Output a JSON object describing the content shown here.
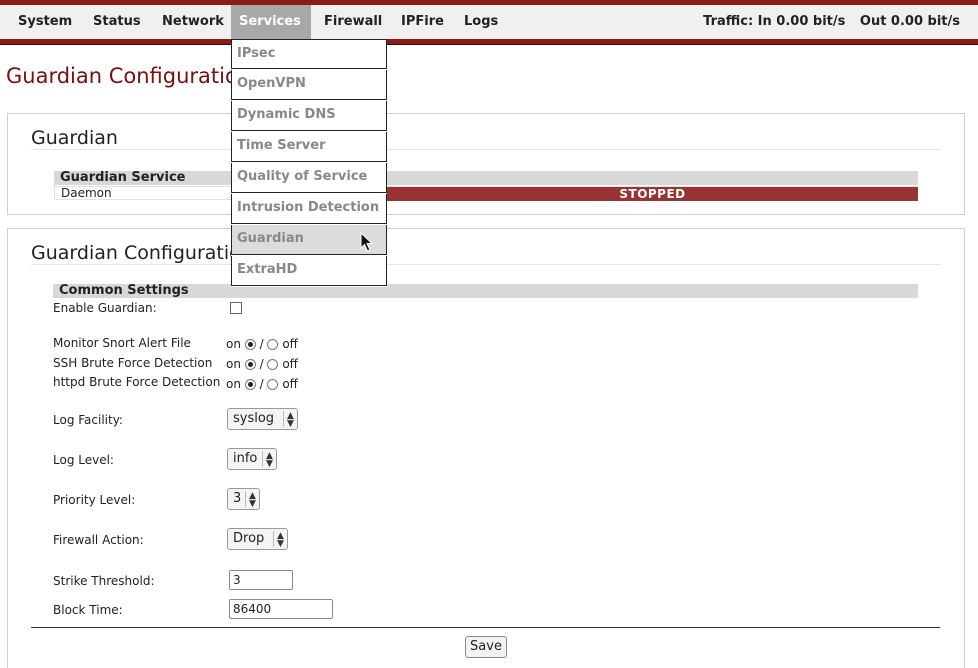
{
  "nav": {
    "items": [
      {
        "label": "System"
      },
      {
        "label": "Status"
      },
      {
        "label": "Network"
      },
      {
        "label": "Services"
      },
      {
        "label": "Firewall"
      },
      {
        "label": "IPFire"
      },
      {
        "label": "Logs"
      }
    ],
    "traffic_in": "Traffic: In 0.00 bit/s",
    "traffic_out": "Out 0.00 bit/s"
  },
  "dropdown": {
    "items": [
      {
        "label": "IPsec"
      },
      {
        "label": "OpenVPN"
      },
      {
        "label": "Dynamic DNS"
      },
      {
        "label": "Time Server"
      },
      {
        "label": "Quality of Service"
      },
      {
        "label": "Intrusion Detection"
      },
      {
        "label": "Guardian"
      },
      {
        "label": "ExtraHD"
      }
    ]
  },
  "page_title": "Guardian Configuration",
  "status_panel": {
    "title": "Guardian",
    "section": "Guardian Service",
    "row_label": "Daemon",
    "status": "STOPPED"
  },
  "config_panel": {
    "title": "Guardian Configuration",
    "section": "Common Settings",
    "enable_label": "Enable Guardian:",
    "radio_rows": [
      {
        "label": "Monitor Snort Alert File",
        "on": "on",
        "sep": "/",
        "off": "off"
      },
      {
        "label": "SSH Brute Force Detection",
        "on": "on",
        "sep": "/",
        "off": "off"
      },
      {
        "label": "httpd Brute Force Detection",
        "on": "on",
        "sep": "/",
        "off": "off"
      }
    ],
    "log_facility_label": "Log Facility:",
    "log_facility_value": "syslog",
    "log_level_label": "Log Level:",
    "log_level_value": "info",
    "priority_label": "Priority Level:",
    "priority_value": "3",
    "firewall_action_label": "Firewall Action:",
    "firewall_action_value": "Drop",
    "strike_label": "Strike Threshold:",
    "strike_value": "3",
    "block_label": "Block Time:",
    "block_value": "86400",
    "save_label": "Save"
  },
  "colors": {
    "brand_red": "#8c1c1c",
    "status_stopped": "#993333",
    "title_color": "#7a0f0f"
  }
}
